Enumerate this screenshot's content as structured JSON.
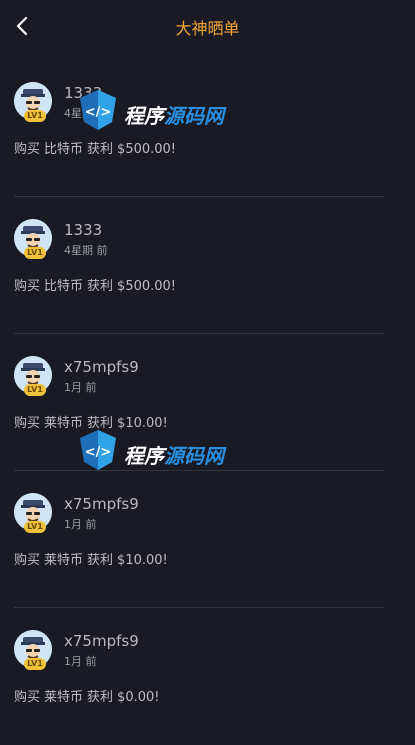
{
  "header": {
    "title": "大神晒单"
  },
  "posts": [
    {
      "username": "1333",
      "time": "4星期 前",
      "level": "LV1",
      "action": "购买",
      "coin": "比特币",
      "profit_label": "获利",
      "amount": "$500.00!"
    },
    {
      "username": "1333",
      "time": "4星期 前",
      "level": "LV1",
      "action": "购买",
      "coin": "比特币",
      "profit_label": "获利",
      "amount": "$500.00!"
    },
    {
      "username": "x75mpfs9",
      "time": "1月 前",
      "level": "LV1",
      "action": "购买",
      "coin": "莱特币",
      "profit_label": "获利",
      "amount": "$10.00!"
    },
    {
      "username": "x75mpfs9",
      "time": "1月 前",
      "level": "LV1",
      "action": "购买",
      "coin": "莱特币",
      "profit_label": "获利",
      "amount": "$10.00!"
    },
    {
      "username": "x75mpfs9",
      "time": "1月 前",
      "level": "LV1",
      "action": "购买",
      "coin": "莱特币",
      "profit_label": "获利",
      "amount": "$0.00!"
    }
  ],
  "watermark": {
    "text_a": "程序",
    "text_b": "源码网"
  },
  "colors": {
    "background": "#1a1a24",
    "title_accent": "#f2a638",
    "level_badge": "#f0c23a",
    "watermark_blue": "#2a8fe0"
  },
  "icons": {
    "back": "chevron-left-icon",
    "avatar": "user-avatar-icon",
    "watermark_logo": "code-shield-icon"
  }
}
